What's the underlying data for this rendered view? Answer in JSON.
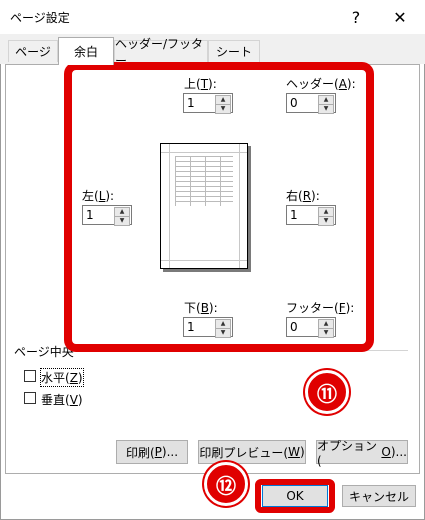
{
  "window": {
    "title": "ページ設定",
    "help_glyph": "?",
    "close_glyph": "✕"
  },
  "tabs": [
    {
      "label": "ページ"
    },
    {
      "label": "余白"
    },
    {
      "label": "ヘッダー/フッター"
    },
    {
      "label": "シート"
    }
  ],
  "margins": {
    "top": {
      "label": "上(",
      "key": "T",
      "suffix": "):",
      "value": "1"
    },
    "header": {
      "label": "ヘッダー(",
      "key": "A",
      "suffix": "):",
      "value": "0"
    },
    "left": {
      "label": "左(",
      "key": "L",
      "suffix": "):",
      "value": "1"
    },
    "right": {
      "label": "右(",
      "key": "R",
      "suffix": "):",
      "value": "1"
    },
    "bottom": {
      "label": "下(",
      "key": "B",
      "suffix": "):",
      "value": "1"
    },
    "footer": {
      "label": "フッター(",
      "key": "F",
      "suffix": "):",
      "value": "0"
    }
  },
  "center": {
    "group_label": "ページ中央",
    "horizontal": {
      "label": "水平(",
      "key": "Z",
      "suffix": ")"
    },
    "vertical": {
      "label": "垂直(",
      "key": "V",
      "suffix": ")"
    }
  },
  "buttons": {
    "print": {
      "label": "印刷(",
      "key": "P",
      "suffix": ")..."
    },
    "preview": {
      "label": "印刷プレビュー(",
      "key": "W",
      "suffix": ")"
    },
    "options": {
      "label": "オプション(",
      "key": "O",
      "suffix": ")..."
    },
    "ok": "OK",
    "cancel": "キャンセル"
  },
  "annotations": {
    "badge1": "⑪",
    "badge2": "⑫"
  },
  "colors": {
    "highlight": "#e00000"
  }
}
